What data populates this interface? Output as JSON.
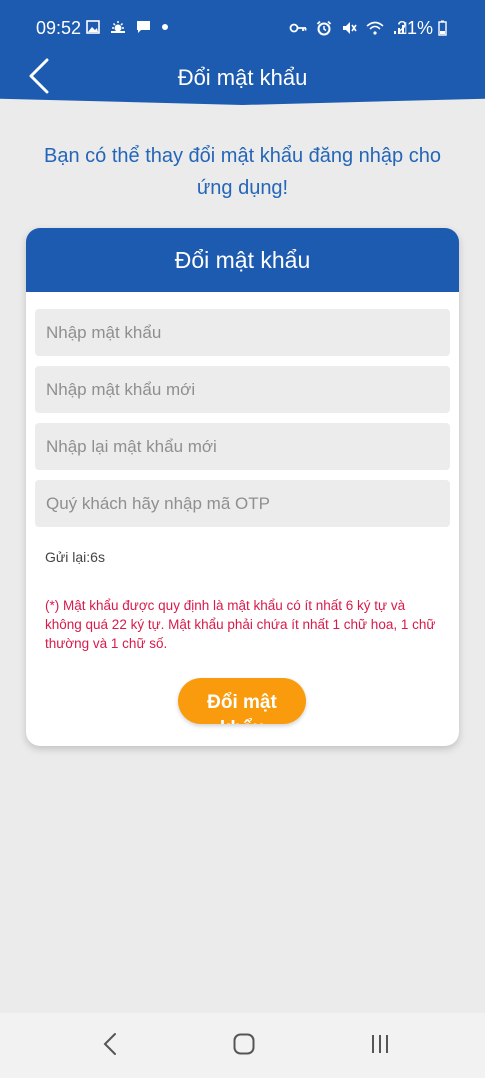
{
  "status_bar": {
    "time": "09:52",
    "battery": "21%",
    "left_icons": [
      "gallery-icon",
      "weather-icon",
      "message-icon",
      "dot-icon"
    ],
    "right_icons": [
      "key-icon",
      "alarm-icon",
      "mute-icon",
      "wifi-icon",
      "signal-icon"
    ]
  },
  "header": {
    "title": "Đổi mật khẩu",
    "back_icon": "chevron-left-icon"
  },
  "intro_text": "Bạn có thể thay đổi mật khẩu đăng nhập cho ứng dụng!",
  "form": {
    "title": "Đổi mật khẩu",
    "current_password_placeholder": "Nhập mật khẩu",
    "new_password_placeholder": "Nhập mật khẩu mới",
    "confirm_password_placeholder": "Nhập lại mật khẩu mới",
    "otp_placeholder": "Quý khách hãy nhập mã OTP",
    "resend_text": "Gửi lại:6s",
    "note": "(*) Mật khẩu được quy định là mật khẩu có ít nhất 6 ký tự và không quá 22 ký tự. Mật khẩu phải chứa ít nhất 1 chữ hoa, 1 chữ thường và 1 chữ số.",
    "submit_label": "Đổi mật khẩu"
  },
  "system_nav": {
    "back_icon": "back-icon",
    "home_icon": "home-icon",
    "recents_icon": "recents-icon"
  },
  "colors": {
    "primary": "#1d5bb0",
    "intro_text": "#2466b8",
    "note_text": "#d81b4a",
    "button": "#f99b0d",
    "background": "#ebebeb"
  }
}
